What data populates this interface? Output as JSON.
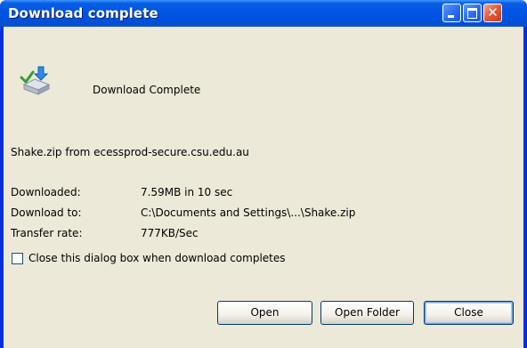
{
  "window": {
    "title": "Download complete"
  },
  "titlebar_buttons": {
    "close_glyph": "✕"
  },
  "dialog": {
    "heading": "Download Complete",
    "source": "Shake.zip from ecessprod-secure.csu.edu.au",
    "rows": [
      {
        "label": "Downloaded:",
        "value": "7.59MB in 10 sec"
      },
      {
        "label": "Download to:",
        "value": "C:\\Documents and Settings\\...\\Shake.zip"
      },
      {
        "label": "Transfer rate:",
        "value": "777KB/Sec"
      }
    ],
    "checkbox": {
      "label": "Close this dialog box when download completes",
      "checked": false
    }
  },
  "buttons": {
    "open": "Open",
    "open_folder": "Open Folder",
    "close": "Close"
  },
  "icons": {
    "download_icon": "download-complete-icon"
  },
  "colors": {
    "titlebar": "#0054e3",
    "client_bg": "#ece9d8",
    "close_button": "#e4583a"
  }
}
